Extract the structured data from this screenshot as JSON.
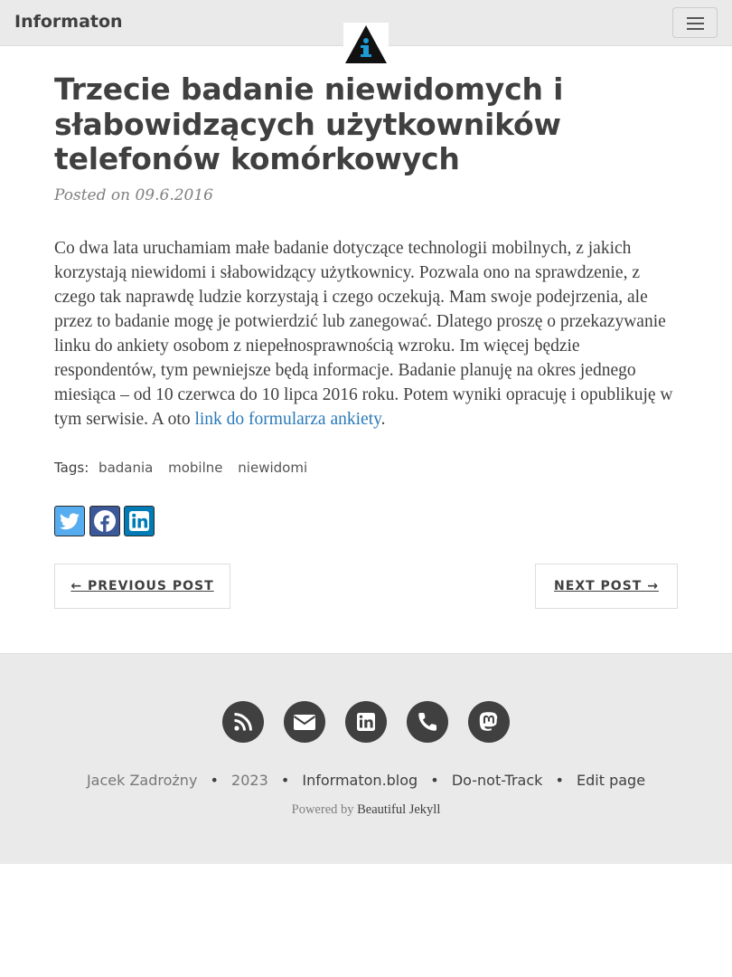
{
  "navbar": {
    "brand": "Informaton",
    "menu_icon": "hamburger-menu-icon",
    "logo_icon": "info-triangle-logo"
  },
  "post": {
    "title": "Trzecie badanie niewidomych i słabowidzących użytkowników telefonów komórkowych",
    "meta": "Posted on 09.6.2016",
    "body": "Co dwa lata uruchamiam małe badanie dotyczące technologii mobilnych, z jakich korzystają niewidomi i słabowidzący użytkownicy. Pozwala ono na sprawdzenie, z czego tak naprawdę ludzie korzystają i czego oczekują. Mam swoje podejrzenia, ale przez to badanie mogę je potwierdzić lub zanegować. Dlatego proszę o przekazywanie linku do ankiety osobom z niepełnosprawnością wzroku. Im więcej będzie respondentów, tym pewniejsze będą informacje. Badanie planuję na okres jednego miesiąca – od 10 czerwca do 10 lipca 2016 roku. Potem wyniki opracuję i opublikuję w tym serwisie. A oto ",
    "link_text": "link do formularza ankiety",
    "body_end": "."
  },
  "tags": {
    "label": "Tags:",
    "items": [
      "badania",
      "mobilne",
      "niewidomi"
    ]
  },
  "share": {
    "buttons": [
      {
        "icon": "twitter-icon",
        "color": "#55acee"
      },
      {
        "icon": "facebook-icon",
        "color": "#3b5998"
      },
      {
        "icon": "linkedin-icon",
        "color": "#007bb6"
      }
    ]
  },
  "pager": {
    "previous": "← PREVIOUS POST",
    "next": "NEXT POST →"
  },
  "footer": {
    "social_icons": [
      "rss-icon",
      "email-icon",
      "linkedin-icon",
      "phone-icon",
      "mastodon-icon"
    ],
    "author": "Jacek Zadrożny",
    "year": "2023",
    "site": "Informaton.blog",
    "dnt": "Do-not-Track",
    "edit": "Edit page",
    "powered_prefix": "Powered by",
    "powered_link": "Beautiful Jekyll",
    "sep": "•"
  }
}
